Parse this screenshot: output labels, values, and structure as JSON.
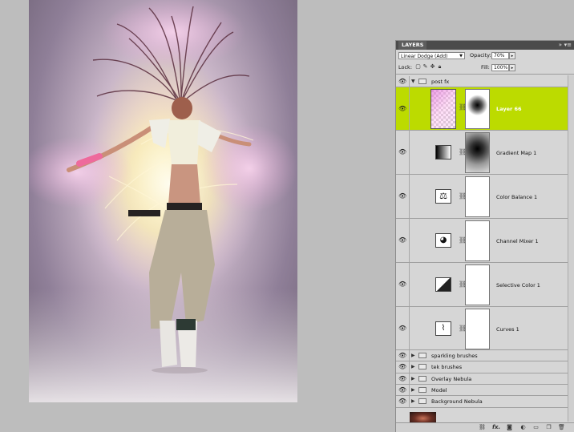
{
  "panel": {
    "tab": "LAYERS",
    "collapse_icon": "double-chevron-right-icon",
    "menu_icon": "panel-menu-icon",
    "blend_mode": "Linear Dodge (Add)",
    "opacity_label": "Opacity:",
    "opacity_value": "70%",
    "lock_label": "Lock:",
    "fill_label": "Fill:",
    "fill_value": "100%"
  },
  "layers": [
    {
      "name": "post fx",
      "type": "group",
      "expanded": true
    },
    {
      "name": "Layer 66",
      "type": "pixel",
      "selected": true
    },
    {
      "name": "Gradient Map 1",
      "type": "adjustment",
      "icon": "gradient-map-icon"
    },
    {
      "name": "Color Balance 1",
      "type": "adjustment",
      "icon": "color-balance-icon"
    },
    {
      "name": "Channel Mixer 1",
      "type": "adjustment",
      "icon": "channel-mixer-icon"
    },
    {
      "name": "Selective Color 1",
      "type": "adjustment",
      "icon": "selective-color-icon"
    },
    {
      "name": "Curves 1",
      "type": "adjustment",
      "icon": "curves-icon"
    },
    {
      "name": "sparkling brushes",
      "type": "group"
    },
    {
      "name": "tek brushes",
      "type": "group"
    },
    {
      "name": "Overlay Nebula",
      "type": "group"
    },
    {
      "name": "Model",
      "type": "group"
    },
    {
      "name": "Background Nebula",
      "type": "group"
    }
  ],
  "bottom_icons": [
    "link-icon",
    "fx-icon",
    "mask-icon",
    "adjustment-icon",
    "folder-icon",
    "new-layer-icon",
    "trash-icon"
  ],
  "bottom_fx_label": "fx."
}
